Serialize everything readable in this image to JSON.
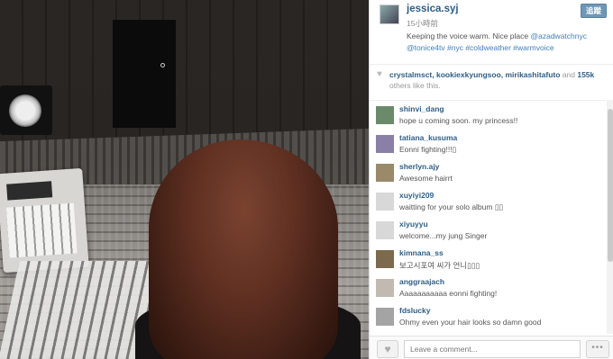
{
  "post": {
    "username": "jessica.syj",
    "timestamp": "15小時前",
    "follow_label": "追蹤",
    "caption": {
      "text": "Keeping the voice warm. Nice place ",
      "mention1": "@azadwatchnyc",
      "mention2": "@tonice4tv",
      "tags": " #nyc #coldweather #warmvoice"
    }
  },
  "likes": {
    "names": "crystalmsct, kookiexkyungsoo, mirikashitafuto",
    "and": " and ",
    "count": "155k",
    "suffix": " others like this."
  },
  "comments": [
    {
      "user": "shinvi_dang",
      "text": "hope u coming soon. my princess!!",
      "avatar": "#6b8a6b"
    },
    {
      "user": "tatiana_kusuma",
      "text": "Eonni fighting!!!▯",
      "avatar": "#8a7fa6"
    },
    {
      "user": "sherlyn.ajy",
      "text": "Awesome hairrt",
      "avatar": "#9a8a6a"
    },
    {
      "user": "xuyiyi209",
      "text": "waitting for your solo album ▯▯",
      "avatar": "#d8d8d8"
    },
    {
      "user": "xiyuyyu",
      "text": "welcome...my jung Singer",
      "avatar": "#d8d8d8"
    },
    {
      "user": "kimnana_ss",
      "text": "보고시포여 씨가 언니▯▯▯",
      "avatar": "#7c6a4e"
    },
    {
      "user": "anggraajach",
      "text": "Aaaaaaaaaaa eonni fighting!",
      "avatar": "#c2b9b0"
    },
    {
      "user": "fdslucky",
      "text": "Ohmy even your hair looks so damn good",
      "avatar": "#a4a4a4"
    }
  ],
  "footer": {
    "comment_placeholder": "Leave a comment...",
    "more_label": "•••"
  }
}
